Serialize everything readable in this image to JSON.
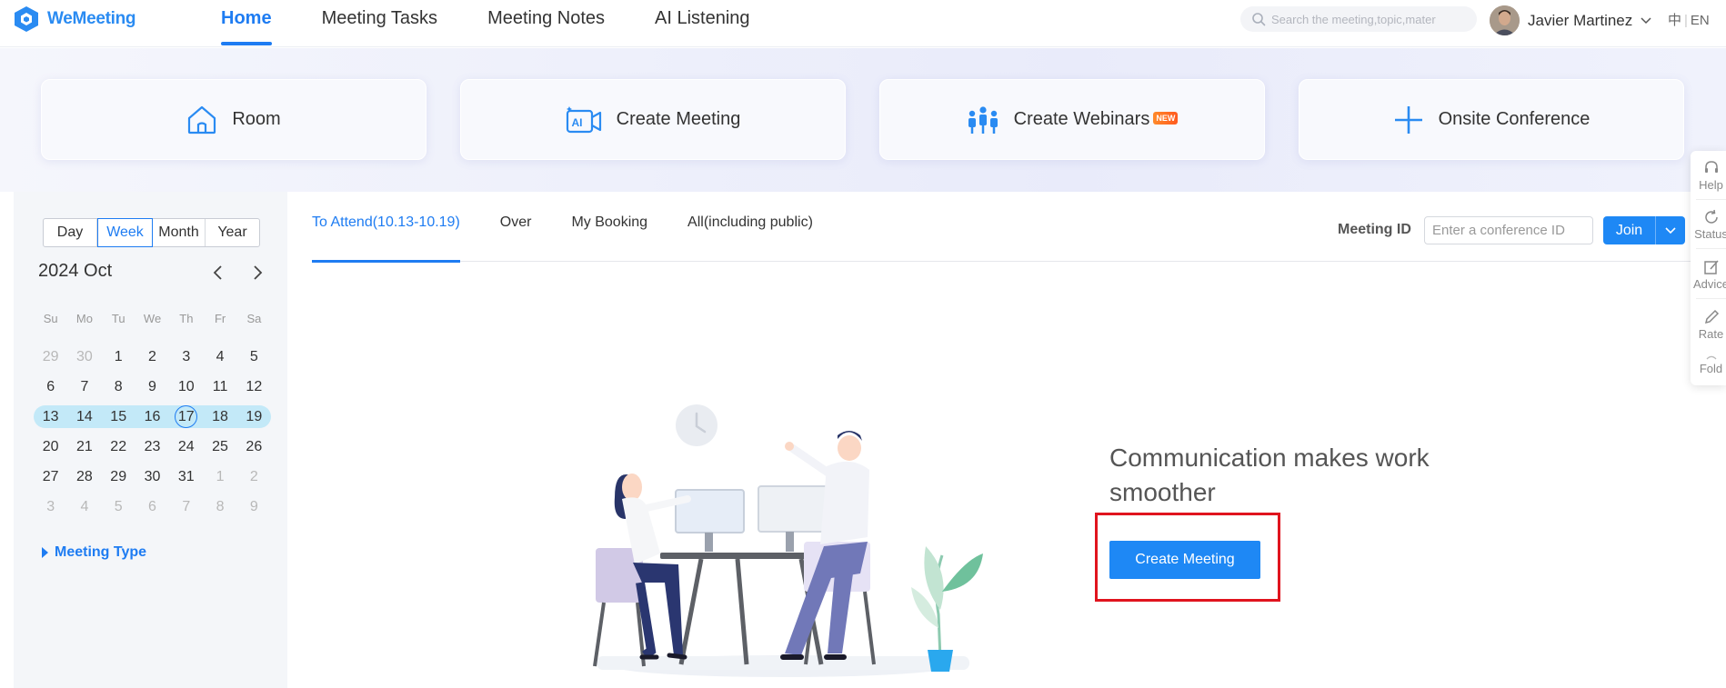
{
  "app": {
    "name": "WeMeeting",
    "brand_color": "#1e7cf2"
  },
  "nav": {
    "tabs": [
      {
        "label": "Home",
        "active": true
      },
      {
        "label": "Meeting Tasks",
        "active": false
      },
      {
        "label": "Meeting Notes",
        "active": false
      },
      {
        "label": "AI Listening",
        "active": false
      }
    ]
  },
  "search": {
    "placeholder": "Search the meeting,topic,mater",
    "icon": "search-icon"
  },
  "user": {
    "name": "Javier Martinez",
    "icon": "chevron-down-icon"
  },
  "language": {
    "zh": "中",
    "separator": "|",
    "en": "EN"
  },
  "quick_actions": [
    {
      "label": "Room",
      "icon": "house-icon"
    },
    {
      "label": "Create Meeting",
      "icon": "ai-camera-icon"
    },
    {
      "label": "Create Webinars",
      "icon": "webinar-people-icon",
      "badge": "NEW"
    },
    {
      "label": "Onsite Conference",
      "icon": "plus-icon"
    }
  ],
  "calendar": {
    "views": [
      {
        "label": "Day",
        "selected": false
      },
      {
        "label": "Week",
        "selected": true
      },
      {
        "label": "Month",
        "selected": false
      },
      {
        "label": "Year",
        "selected": false
      }
    ],
    "title": "2024 Oct",
    "weekdays": [
      "Su",
      "Mo",
      "Tu",
      "We",
      "Th",
      "Fr",
      "Sa"
    ],
    "weeks": [
      {
        "days": [
          "29",
          "30",
          "1",
          "2",
          "3",
          "4",
          "5"
        ]
      },
      {
        "days": [
          "6",
          "7",
          "8",
          "9",
          "10",
          "11",
          "12"
        ]
      },
      {
        "days": [
          "13",
          "14",
          "15",
          "16",
          "17",
          "18",
          "19"
        ]
      },
      {
        "days": [
          "20",
          "21",
          "22",
          "23",
          "24",
          "25",
          "26"
        ]
      },
      {
        "days": [
          "27",
          "28",
          "29",
          "30",
          "31",
          "1",
          "2"
        ]
      },
      {
        "days": [
          "3",
          "4",
          "5",
          "6",
          "7",
          "8",
          "9"
        ]
      }
    ],
    "highlight_color": "#c3e9f8",
    "today": "17",
    "meeting_type": "Meeting Type"
  },
  "meeting_tabs": [
    {
      "label": "To Attend(10.13-10.19)",
      "active": true
    },
    {
      "label": "Over",
      "active": false
    },
    {
      "label": "My Booking",
      "active": false
    },
    {
      "label": "All(including public)",
      "active": false
    }
  ],
  "meeting_id": {
    "label": "Meeting ID",
    "placeholder": "Enter a conference ID",
    "join_label": "Join"
  },
  "empty_state": {
    "message": "Communication makes work smoother",
    "button": "Create Meeting",
    "highlight_color": "#e0141e"
  },
  "side_rail": [
    {
      "label": "Help",
      "icon": "headset-icon"
    },
    {
      "label": "Status",
      "icon": "refresh-icon"
    },
    {
      "label": "Advice",
      "icon": "edit-box-icon"
    },
    {
      "label": "Rate",
      "icon": "pen-icon"
    },
    {
      "label": "Fold",
      "icon": "fold-icon"
    }
  ]
}
